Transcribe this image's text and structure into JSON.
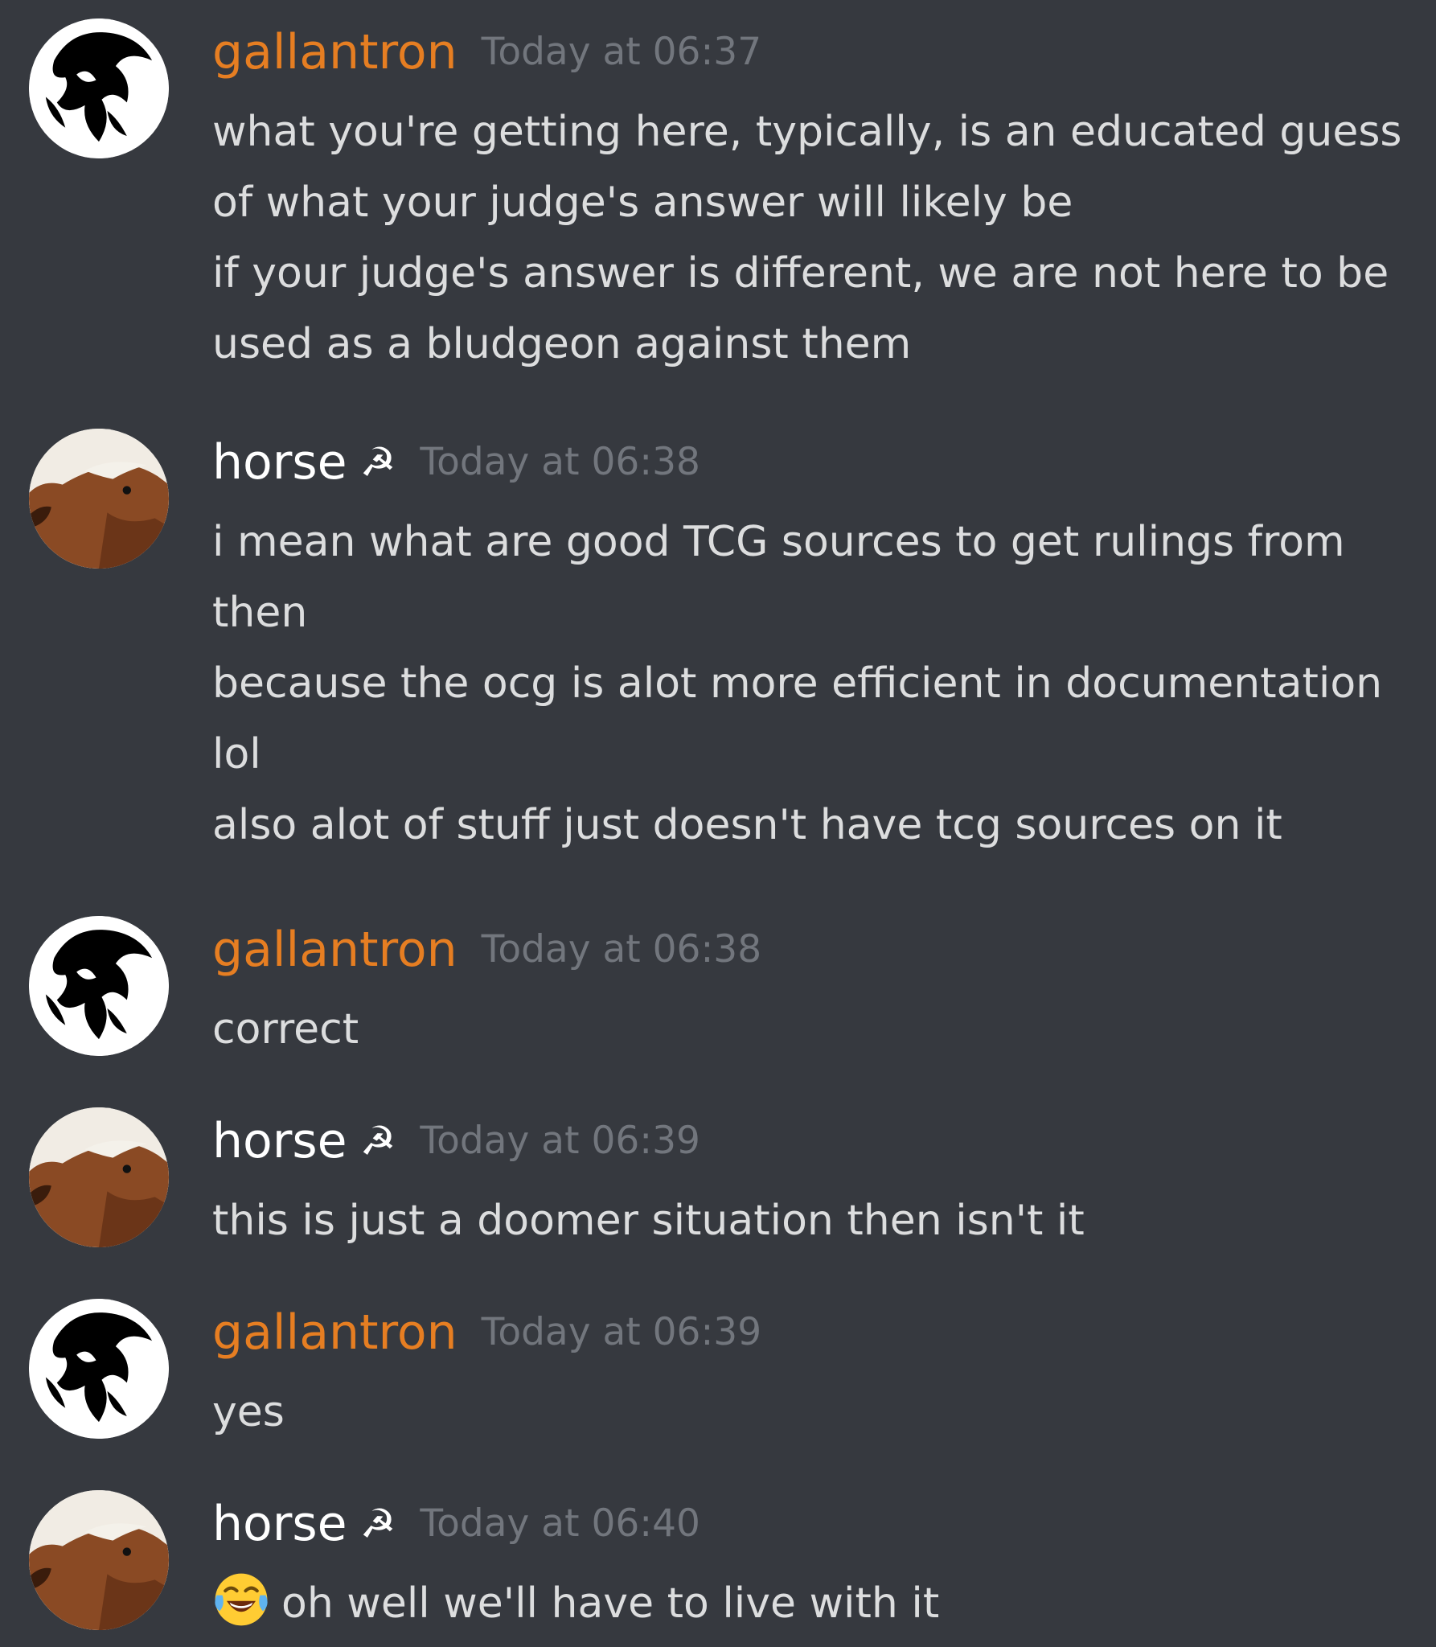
{
  "users": {
    "gallantron": {
      "name": "gallantron",
      "color": "#e67e22",
      "avatar_icon": "black-white-art-avatar-icon"
    },
    "horse": {
      "name": "horse",
      "color": "#ffffff",
      "badge_glyph": "☭",
      "avatar_icon": "horse-head-avatar-icon"
    }
  },
  "messages": [
    {
      "user": "gallantron",
      "timestamp": "Today at 06:37",
      "lines": [
        "what you're getting here, typically, is an educated guess",
        "of what your judge's answer will likely be",
        "if your judge's answer is different, we are not here to be",
        "used as a bludgeon against them"
      ]
    },
    {
      "user": "horse",
      "timestamp": "Today at 06:38",
      "lines": [
        "i mean what are good TCG sources to get rulings from",
        "then",
        "because the ocg is alot more efficient in documentation",
        "lol",
        "also alot of stuff just doesn't have tcg sources on it"
      ]
    },
    {
      "user": "gallantron",
      "timestamp": "Today at 06:38",
      "lines": [
        "correct"
      ]
    },
    {
      "user": "horse",
      "timestamp": "Today at 06:39",
      "lines": [
        "this is just a doomer situation then isn't it"
      ]
    },
    {
      "user": "gallantron",
      "timestamp": "Today at 06:39",
      "lines": [
        "yes"
      ]
    },
    {
      "user": "horse",
      "timestamp": "Today at 06:40",
      "emoji": "face-with-tears-of-joy-icon",
      "lines": [
        "oh well we'll have to live with it"
      ]
    }
  ]
}
